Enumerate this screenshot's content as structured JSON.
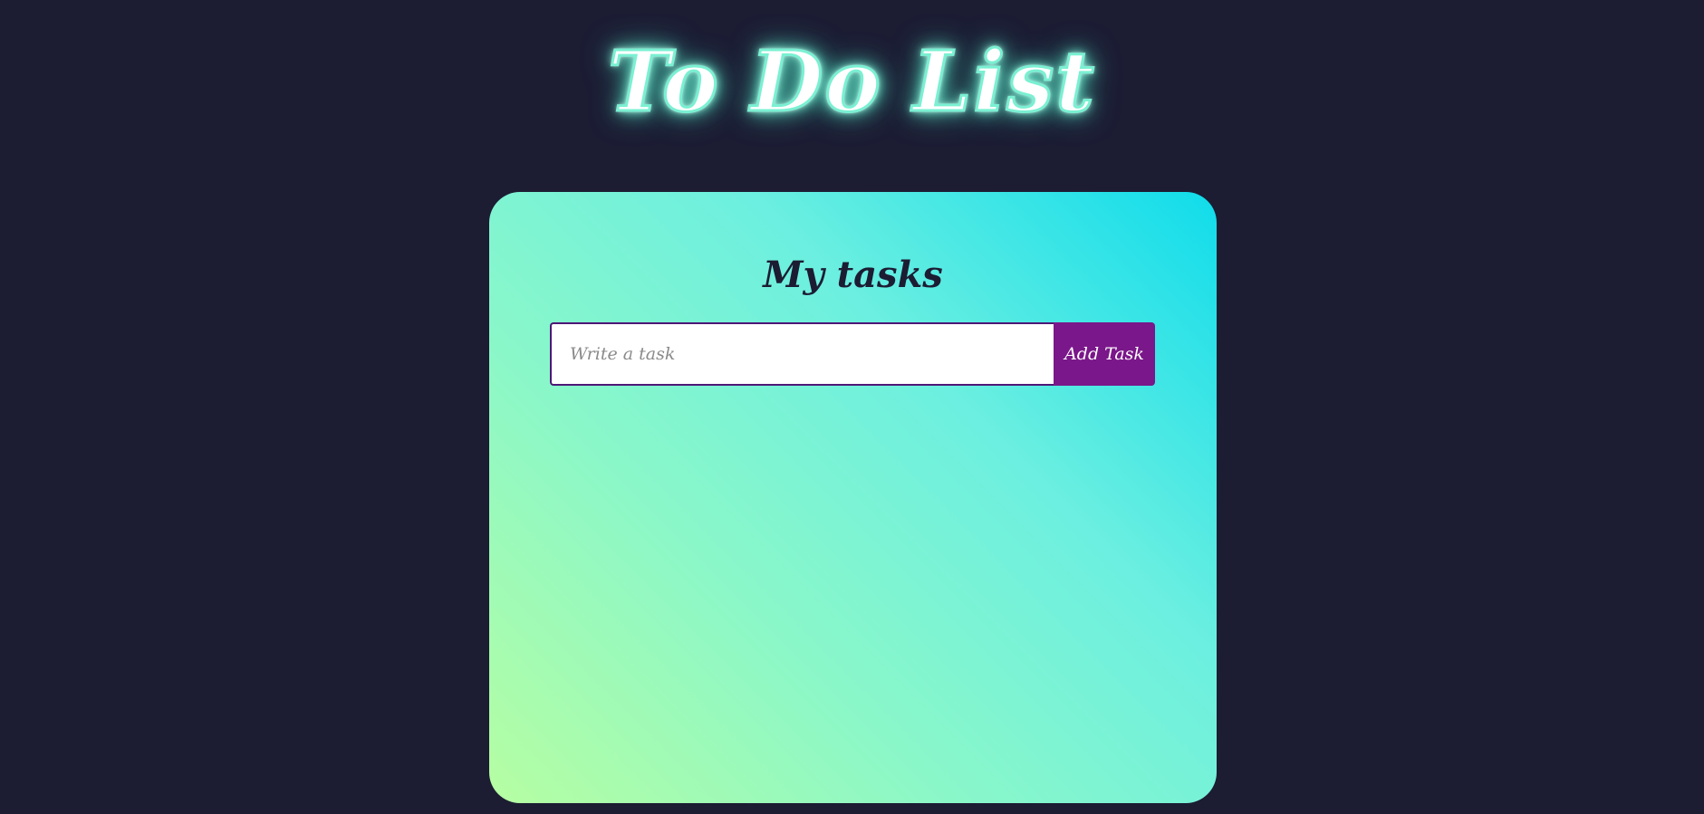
{
  "header": {
    "title": "To Do List"
  },
  "card": {
    "title": "My tasks",
    "input_placeholder": "Write a task",
    "input_value": "",
    "add_button_label": "Add Task",
    "tasks": []
  },
  "colors": {
    "background": "#1c1c33",
    "title_glow": "#7af0d2",
    "card_gradient_start": "#b6fea2",
    "card_gradient_end": "#10dceb",
    "button": "#7a178a",
    "input_border": "#4e1776"
  }
}
